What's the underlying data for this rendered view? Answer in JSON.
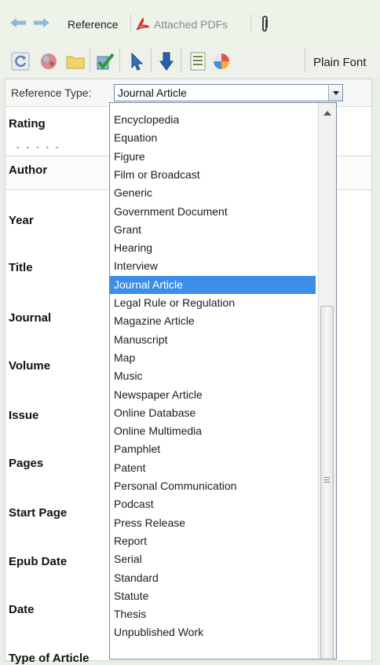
{
  "tabs": [
    {
      "label": "Reference",
      "active": true
    },
    {
      "label": "Attached PDFs",
      "active": false
    }
  ],
  "toolbar": {
    "buttons": [
      "refresh-icon",
      "globe-icon",
      "folder-icon",
      "checkmark-icon",
      "cursor-icon",
      "tag-icon",
      "list-icon",
      "color-wheel-icon"
    ],
    "font_label": "Plain Font"
  },
  "reference_type": {
    "label": "Reference Type:",
    "value": "Journal Article"
  },
  "fields": [
    "Rating",
    "Author",
    "Year",
    "Title",
    "Journal",
    "Volume",
    "Issue",
    "Pages",
    "Start Page",
    "Epub Date",
    "Date",
    "Type of Article"
  ],
  "dropdown": {
    "options": [
      "Encyclopedia",
      "Equation",
      "Figure",
      "Film or Broadcast",
      "Generic",
      "Government Document",
      "Grant",
      "Hearing",
      "Interview",
      "Journal Article",
      "Legal Rule or Regulation",
      "Magazine Article",
      "Manuscript",
      "Map",
      "Music",
      "Newspaper Article",
      "Online Database",
      "Online Multimedia",
      "Pamphlet",
      "Patent",
      "Personal Communication",
      "Podcast",
      "Press Release",
      "Report",
      "Serial",
      "Standard",
      "Statute",
      "Thesis",
      "Unpublished Work"
    ],
    "selected": "Journal Article"
  },
  "colors": {
    "selection": "#3d8ee8",
    "background": "#e9efe6"
  }
}
